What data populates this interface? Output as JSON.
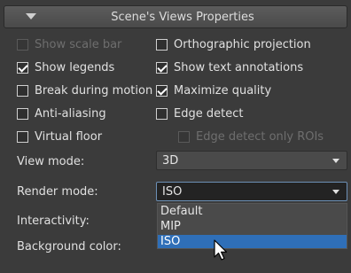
{
  "panel": {
    "title": "Scene's Views Properties"
  },
  "checkboxes": {
    "show_scale_bar": {
      "label": "Show scale bar",
      "checked": false,
      "disabled": true
    },
    "orthographic_projection": {
      "label": "Orthographic projection",
      "checked": false
    },
    "show_legends": {
      "label": "Show legends",
      "checked": true
    },
    "show_text_annotations": {
      "label": "Show text annotations",
      "checked": true
    },
    "break_during_motion": {
      "label": "Break during motion",
      "checked": false
    },
    "maximize_quality": {
      "label": "Maximize quality",
      "checked": true
    },
    "anti_aliasing": {
      "label": "Anti-aliasing",
      "checked": false
    },
    "edge_detect": {
      "label": "Edge detect",
      "checked": false
    },
    "virtual_floor": {
      "label": "Virtual floor",
      "checked": false
    },
    "edge_detect_only_rois": {
      "label": "Edge detect only ROIs",
      "checked": false,
      "disabled": true
    }
  },
  "view_mode": {
    "label": "View mode:",
    "value": "3D"
  },
  "render_mode": {
    "label": "Render mode:",
    "value": "ISO",
    "options": [
      "Default",
      "MIP",
      "ISO"
    ],
    "highlighted": "ISO"
  },
  "interactivity": {
    "label": "Interactivity:"
  },
  "background_color": {
    "label": "Background color:"
  },
  "colors": {
    "panel_bg": "#3b3b3b",
    "selection": "#2f6fb8",
    "focus_border": "#6c8fb5"
  }
}
